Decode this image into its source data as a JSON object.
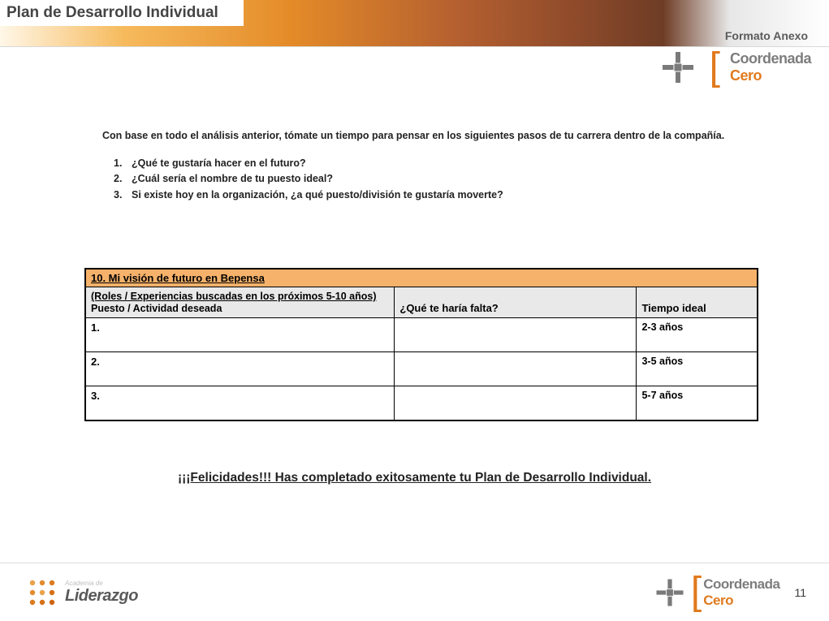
{
  "header": {
    "title": "Plan de Desarrollo Individual",
    "format_label": "Formato Anexo"
  },
  "brand": {
    "line1": "Coordenada",
    "line2": "Cero"
  },
  "content": {
    "intro": "Con base en todo el análisis anterior, tómate un tiempo para pensar en los siguientes pasos de tu carrera dentro de la compañía.",
    "questions": [
      {
        "num": "1.",
        "text": "¿Qué te gustaría hacer en el futuro?"
      },
      {
        "num": "2.",
        "text": "¿Cuál sería el nombre de tu puesto ideal?"
      },
      {
        "num": "3.",
        "text": "Si existe hoy en la organización, ¿a qué puesto/división te gustaría moverte?"
      }
    ]
  },
  "table": {
    "title": "10. Mi visión de futuro en Bepensa",
    "subtitle_line1": "(Roles / Experiencias buscadas en los próximos 5-10 años)",
    "subtitle_line2": "Puesto / Actividad deseada",
    "col2_header": "¿Qué te haría falta?",
    "col3_header": "Tiempo ideal",
    "rows": [
      {
        "num": "1.",
        "col2": "",
        "time": "2-3  años"
      },
      {
        "num": "2.",
        "col2": "",
        "time": "3-5  años"
      },
      {
        "num": "3.",
        "col2": "",
        "time": "5-7  años"
      }
    ]
  },
  "congrats": "¡¡¡Felicidades!!! Has completado exitosamente tu Plan de Desarrollo Individual.",
  "footer": {
    "left_small": "Academia de",
    "left_big": "Liderazgo",
    "page": "11"
  }
}
